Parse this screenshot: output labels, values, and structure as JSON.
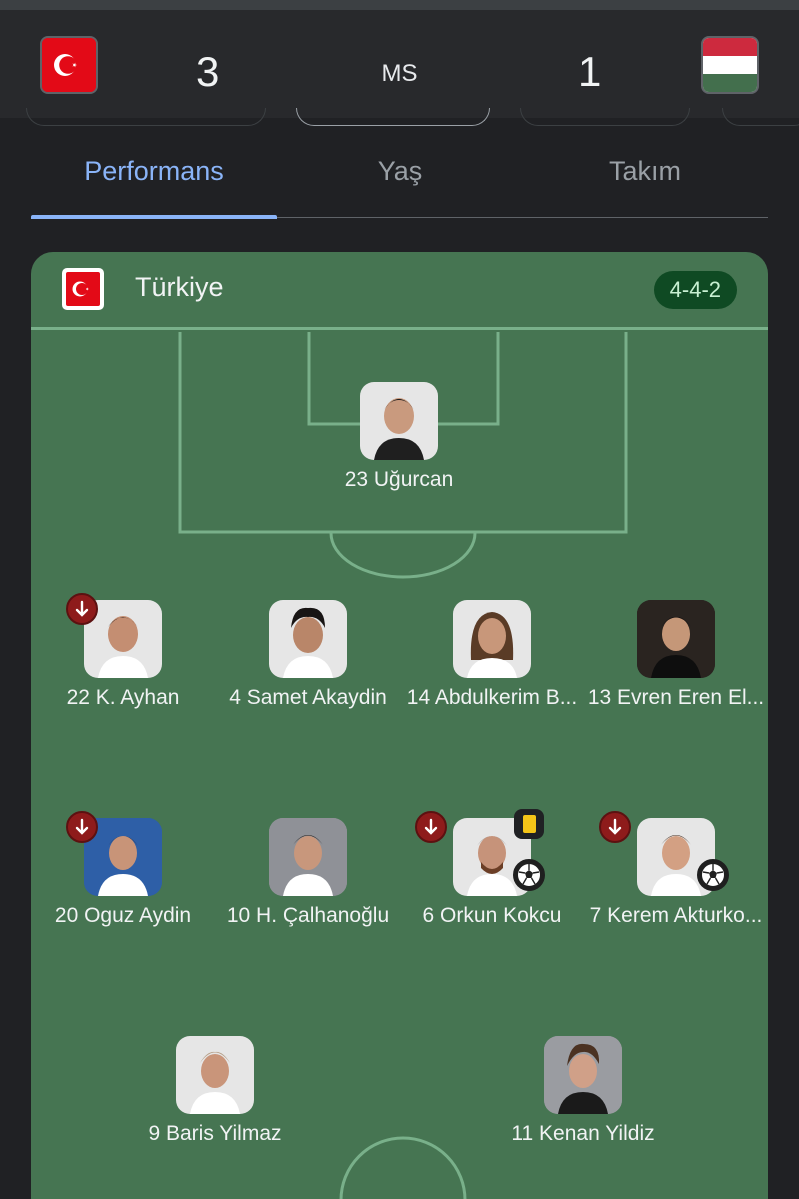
{
  "match": {
    "home_score": "3",
    "away_score": "1",
    "status": "MS",
    "home_flag_icon": "turkey-flag-icon",
    "away_flag_icon": "hungary-flag-icon"
  },
  "tabs": [
    {
      "label": "Performans",
      "active": true
    },
    {
      "label": "Yaş",
      "active": false
    },
    {
      "label": "Takım",
      "active": false
    }
  ],
  "team": {
    "name": "Türkiye",
    "formation": "4-4-2",
    "colors": {
      "pitch": "#467552",
      "lines": "#79b08a",
      "accent": "#8ab4f8"
    }
  },
  "lineup": {
    "goalkeeper": [
      {
        "label": "23 Uğurcan",
        "badges": []
      }
    ],
    "defenders": [
      {
        "label": "22 K. Ayhan",
        "badges": [
          "substitution-out-icon"
        ]
      },
      {
        "label": "4 Samet Akaydin",
        "badges": []
      },
      {
        "label": "14 Abdulkerim B...",
        "badges": []
      },
      {
        "label": "13 Evren Eren El...",
        "badges": []
      }
    ],
    "midfielders": [
      {
        "label": "20 Oguz Aydin",
        "badges": [
          "substitution-out-icon"
        ]
      },
      {
        "label": "10 H. Çalhanoğlu",
        "badges": []
      },
      {
        "label": "6 Orkun Kokcu",
        "badges": [
          "substitution-out-icon",
          "yellow-card-icon",
          "goal-ball-icon"
        ]
      },
      {
        "label": "7 Kerem Akturko...",
        "badges": [
          "substitution-out-icon",
          "goal-ball-icon"
        ]
      }
    ],
    "forwards": [
      {
        "label": "9 Baris Yilmaz",
        "badges": []
      },
      {
        "label": "11 Kenan Yildiz",
        "badges": []
      }
    ]
  }
}
